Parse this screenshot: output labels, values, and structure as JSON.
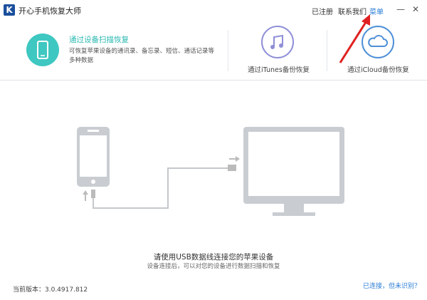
{
  "window": {
    "logo_letter": "K",
    "title": "开心手机恢复大师"
  },
  "topbar": {
    "register": "已注册",
    "contact": "联系我们",
    "menu": "菜单",
    "minimize": "—",
    "close": "✕"
  },
  "options": {
    "device_scan": {
      "title": "通过设备扫描恢复",
      "desc": "可恢复苹果设备的通讯录、备忘录、短信、通话记录等多种数据"
    },
    "itunes": {
      "label": "通过iTunes备份恢复"
    },
    "icloud": {
      "label": "通过iCloud备份恢复"
    }
  },
  "instructions": {
    "main": "请使用USB数据线连接您的苹果设备",
    "sub": "设备连接后，可以对您的设备进行数据扫描和恢复"
  },
  "footer": {
    "version": "当前版本：3.0.4917.812",
    "connected_link": "已连接，但未识别？"
  },
  "colors": {
    "accent_teal": "#3fc7c1",
    "itunes_purple": "#8f8fd8",
    "icloud_blue": "#4e8fd6",
    "link_blue": "#2a7dd6",
    "annotation_red": "#e02020"
  },
  "icons": {
    "device_scan": "phone-icon",
    "itunes": "music-note-icon",
    "icloud": "cloud-icon"
  }
}
